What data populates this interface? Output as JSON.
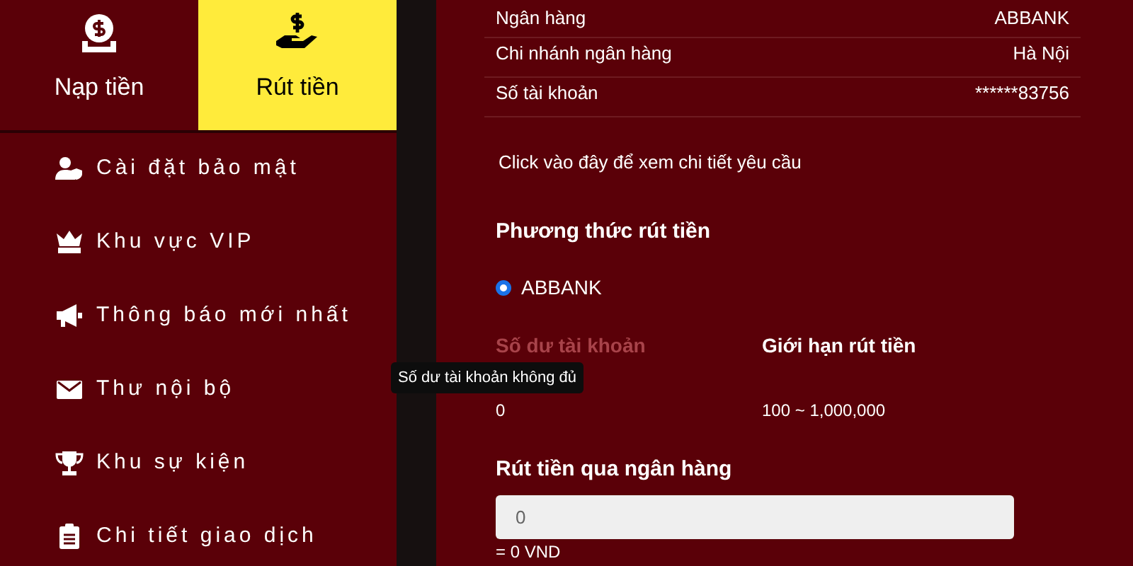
{
  "tabs": [
    {
      "label": "Nạp tiền",
      "kind": "deposit",
      "selected": false
    },
    {
      "label": "Rút tiền",
      "kind": "withdraw",
      "selected": true
    }
  ],
  "menu": [
    {
      "label": "Cài đặt bảo mật",
      "kind": "security"
    },
    {
      "label": "Khu vực VIP",
      "kind": "vip"
    },
    {
      "label": "Thông báo mới nhất",
      "kind": "announce"
    },
    {
      "label": "Thư nội bộ",
      "kind": "mail"
    },
    {
      "label": "Khu sự kiện",
      "kind": "trophy"
    },
    {
      "label": "Chi tiết giao dịch",
      "kind": "clipboard"
    }
  ],
  "bank_info": [
    {
      "label": "Ngân hàng",
      "value": "ABBANK"
    },
    {
      "label": "Chi nhánh ngân hàng",
      "value": "Hà Nội"
    },
    {
      "label": "Số tài khoản",
      "value": "******83756"
    }
  ],
  "details_link": "Click vào đây để xem chi tiết yêu cầu",
  "method": {
    "title": "Phương thức rút tiền",
    "options": [
      {
        "label": "ABBANK",
        "selected": true
      }
    ]
  },
  "balance": {
    "label": "Số dư tài khoản",
    "value": "0",
    "disabled": true,
    "tooltip": "Số dư tài khoản không đủ"
  },
  "limit": {
    "label": "Giới hạn rút tiền",
    "value": "100 ~ 1,000,000"
  },
  "amount": {
    "title": "Rút tiền qua ngân hàng",
    "placeholder": "0",
    "converted": "= 0 VND"
  }
}
